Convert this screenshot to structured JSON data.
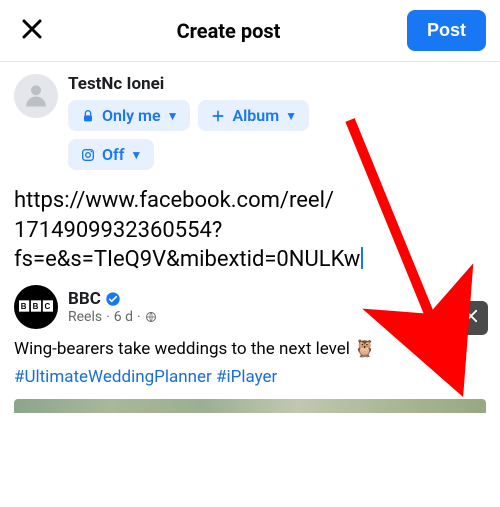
{
  "header": {
    "title": "Create post",
    "post_label": "Post"
  },
  "author": {
    "name": "TestNc Ionei",
    "audience_label": "Only me",
    "album_label": "Album",
    "tagging_label": "Off"
  },
  "post_body": {
    "line1": "https://www.facebook.com/reel/",
    "line2": "1714909932360554?",
    "line3": "fs=e&s=TIeQ9V&mibextid=0NULKw"
  },
  "preview": {
    "publisher": "BBC",
    "sub_prefix": "Reels",
    "age": "6 d",
    "caption": "Wing-bearers take weddings to the next level ",
    "emoji": "🦉",
    "hashtag1": "#UltimateWeddingPlanner",
    "hashtag2": "#iPlayer"
  }
}
